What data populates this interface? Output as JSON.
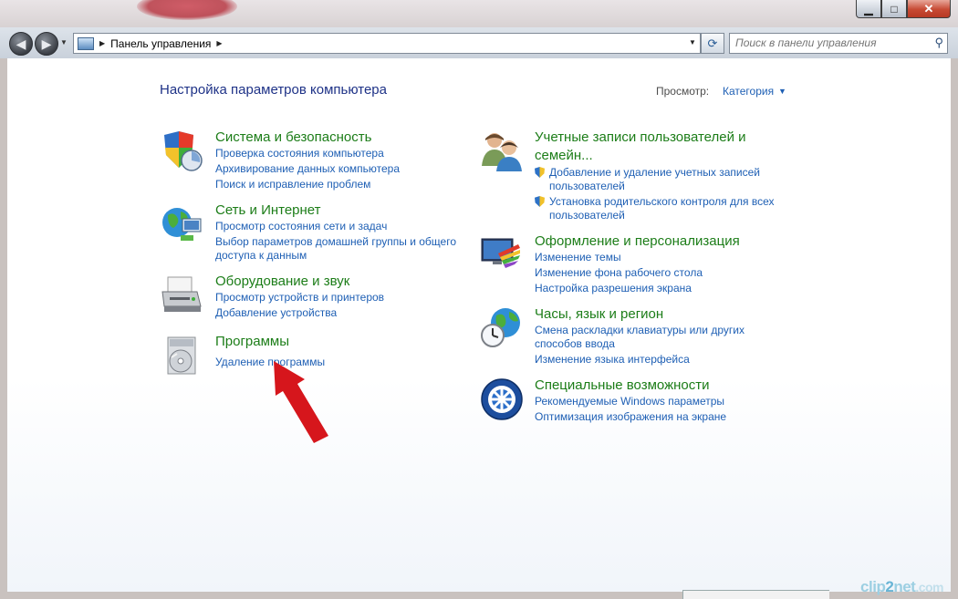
{
  "window": {
    "min_label": "▁",
    "max_label": "□",
    "close_label": "✕"
  },
  "toolbar": {
    "breadcrumb": "Панель управления",
    "search_placeholder": "Поиск в панели управления"
  },
  "main": {
    "heading": "Настройка параметров компьютера",
    "view_by_label": "Просмотр:",
    "view_by_value": "Категория"
  },
  "categories_left": [
    {
      "title": "Система и безопасность",
      "icon": "shield-icon",
      "links": [
        "Проверка состояния компьютера",
        "Архивирование данных компьютера",
        "Поиск и исправление проблем"
      ]
    },
    {
      "title": "Сеть и Интернет",
      "icon": "network-globe-icon",
      "links": [
        "Просмотр состояния сети и задач",
        "Выбор параметров домашней группы и общего",
        "доступа к данным"
      ]
    },
    {
      "title": "Оборудование и звук",
      "icon": "printer-icon",
      "links": [
        "Просмотр устройств и принтеров",
        "Добавление устройства"
      ]
    },
    {
      "title": "Программы",
      "icon": "programs-disc-icon",
      "links": [
        "Удаление программы"
      ]
    }
  ],
  "categories_right": [
    {
      "title_line1": "Учетные записи пользователей и",
      "title_line2": "семейн...",
      "icon": "users-icon",
      "links": [
        "Добавление и удаление учетных записей",
        "пользователей",
        "Установка родительского контроля для всех",
        "пользователей"
      ]
    },
    {
      "title": "Оформление и персонализация",
      "icon": "monitor-paint-icon",
      "links": [
        "Изменение темы",
        "Изменение фона рабочего стола",
        "Настройка разрешения экрана"
      ]
    },
    {
      "title": "Часы, язык и регион",
      "icon": "clock-globe-icon",
      "links": [
        "Смена раскладки клавиатуры или других",
        "способов ввода",
        "Изменение языка интерфейса"
      ]
    },
    {
      "title": "Специальные возможности",
      "icon": "accessibility-icon",
      "links": [
        "Рекомендуемые Windows параметры",
        "Оптимизация изображения на экране"
      ]
    }
  ],
  "annotation": {
    "color": "#d6161c"
  },
  "watermark": {
    "part1": "clip",
    "part2": "2",
    "part3": "net",
    "part4": ".com"
  }
}
